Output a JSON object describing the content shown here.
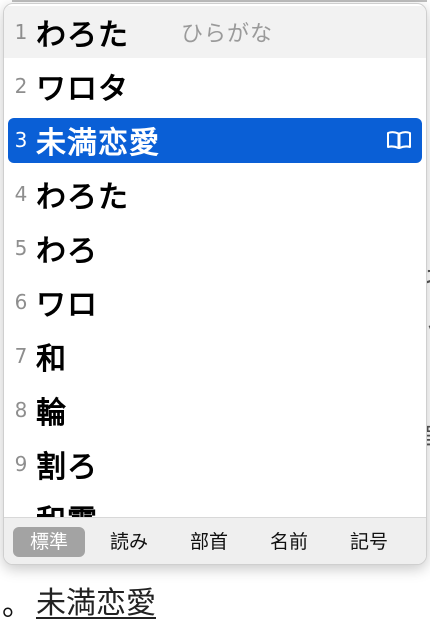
{
  "document": {
    "left_mark": "。",
    "underlined_text": "未満恋愛"
  },
  "candidates": [
    {
      "index": "1",
      "text": "わろた",
      "hint": "ひらがな"
    },
    {
      "index": "2",
      "text": "ワロタ"
    },
    {
      "index": "3",
      "text": "未満恋愛",
      "selected": true
    },
    {
      "index": "4",
      "text": "わろた"
    },
    {
      "index": "5",
      "text": "わろ"
    },
    {
      "index": "6",
      "text": "ワロ"
    },
    {
      "index": "7",
      "text": "和"
    },
    {
      "index": "8",
      "text": "輪"
    },
    {
      "index": "9",
      "text": "割ろ"
    },
    {
      "index": "",
      "text": "和露"
    }
  ],
  "tabs": [
    {
      "label": "標準",
      "active": true
    },
    {
      "label": "読み"
    },
    {
      "label": "部首"
    },
    {
      "label": "名前"
    },
    {
      "label": "記号"
    }
  ],
  "colors": {
    "selection": "#0a5fd6",
    "active_tab": "#a3a3a3"
  },
  "icons": {
    "selected_candidate": "book-icon"
  }
}
